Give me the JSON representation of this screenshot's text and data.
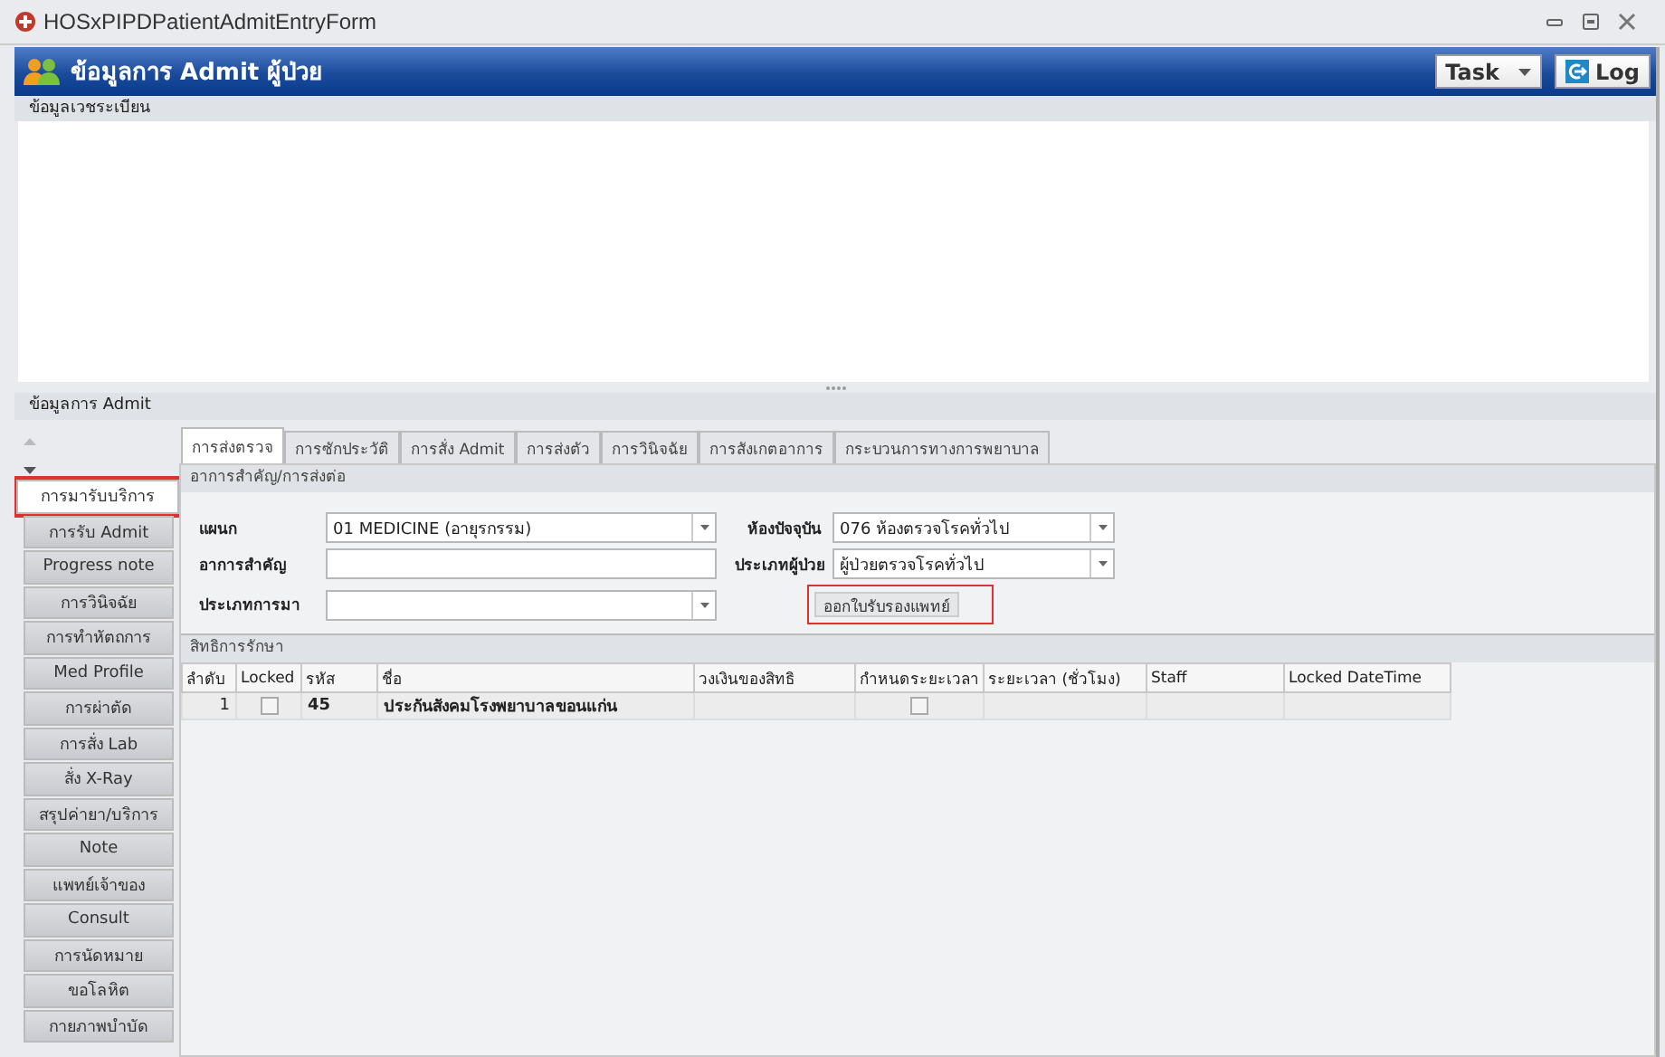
{
  "window": {
    "title": "HOSxPIPDPatientAdmitEntryForm"
  },
  "header": {
    "title": "ข้อมูลการ Admit ผู้ป่วย",
    "task_button": "Task",
    "log_button": "Log"
  },
  "registry_panel": {
    "title": "ข้อมูลเวชระเบียน"
  },
  "admit_panel": {
    "title": "ข้อมูลการ Admit"
  },
  "sidebar": {
    "items": [
      {
        "label": "การมารับบริการ",
        "selected": true,
        "highlighted": true
      },
      {
        "label": "การรับ Admit",
        "selected": false,
        "highlighted": false
      },
      {
        "label": "Progress note",
        "selected": false,
        "highlighted": false
      },
      {
        "label": "การวินิจฉัย",
        "selected": false,
        "highlighted": false
      },
      {
        "label": "การทำหัตถการ",
        "selected": false,
        "highlighted": false
      },
      {
        "label": "Med Profile",
        "selected": false,
        "highlighted": false
      },
      {
        "label": "การผ่าตัด",
        "selected": false,
        "highlighted": false
      },
      {
        "label": "การสั่ง Lab",
        "selected": false,
        "highlighted": false
      },
      {
        "label": "สั่ง X-Ray",
        "selected": false,
        "highlighted": false
      },
      {
        "label": "สรุปค่ายา/บริการ",
        "selected": false,
        "highlighted": false
      },
      {
        "label": "Note",
        "selected": false,
        "highlighted": false
      },
      {
        "label": "แพทย์เจ้าของ",
        "selected": false,
        "highlighted": false
      },
      {
        "label": "Consult",
        "selected": false,
        "highlighted": false
      },
      {
        "label": "การนัดหมาย",
        "selected": false,
        "highlighted": false
      },
      {
        "label": "ขอโลหิต",
        "selected": false,
        "highlighted": false
      },
      {
        "label": "กายภาพบำบัด",
        "selected": false,
        "highlighted": false
      }
    ]
  },
  "tabs": [
    {
      "label": "การส่งตรวจ",
      "selected": true
    },
    {
      "label": "การซักประวัติ",
      "selected": false
    },
    {
      "label": "การสั่ง Admit",
      "selected": false
    },
    {
      "label": "การส่งตัว",
      "selected": false
    },
    {
      "label": "การวินิจฉัย",
      "selected": false
    },
    {
      "label": "การสังเกตอาการ",
      "selected": false
    },
    {
      "label": "กระบวนการทางการพยาบาล",
      "selected": false
    }
  ],
  "symptom_section": {
    "title": "อาการสำคัญ/การส่งต่อ",
    "fields": [
      {
        "label": "แผนก",
        "value": "01 MEDICINE  (อายุรกรรม)",
        "kind": "dropdown"
      },
      {
        "label": "ห้องปัจจุบัน",
        "value": "076 ห้องตรวจโรคทั่วไป",
        "kind": "dropdown"
      },
      {
        "label": "อาการสำคัญ",
        "kind": "text"
      },
      {
        "label": "ประเภทผู้ป่วย",
        "value": "ผู้ป่วยตรวจโรคทั่วไป",
        "kind": "dropdown"
      },
      {
        "label": "ประเภทการมา",
        "kind": "dropdown"
      }
    ],
    "certificate_button": {
      "label": "ออกใบรับรองแพทย์",
      "highlighted": true
    }
  },
  "rights_section": {
    "title": "สิทธิการรักษา",
    "columns": [
      "ลำดับ",
      "Locked",
      "รหัส",
      "ชื่อ",
      "วงเงินของสิทธิ",
      "กำหนดระยะเวลา",
      "ระยะเวลา (ชั่วโมง)",
      "Staff",
      "Locked DateTime"
    ],
    "rows": [
      {
        "number": "1",
        "locked": false,
        "code": "45",
        "name": "ประกันสังคมโรงพยาบาลขอนแก่น",
        "time_limit": false
      }
    ]
  }
}
